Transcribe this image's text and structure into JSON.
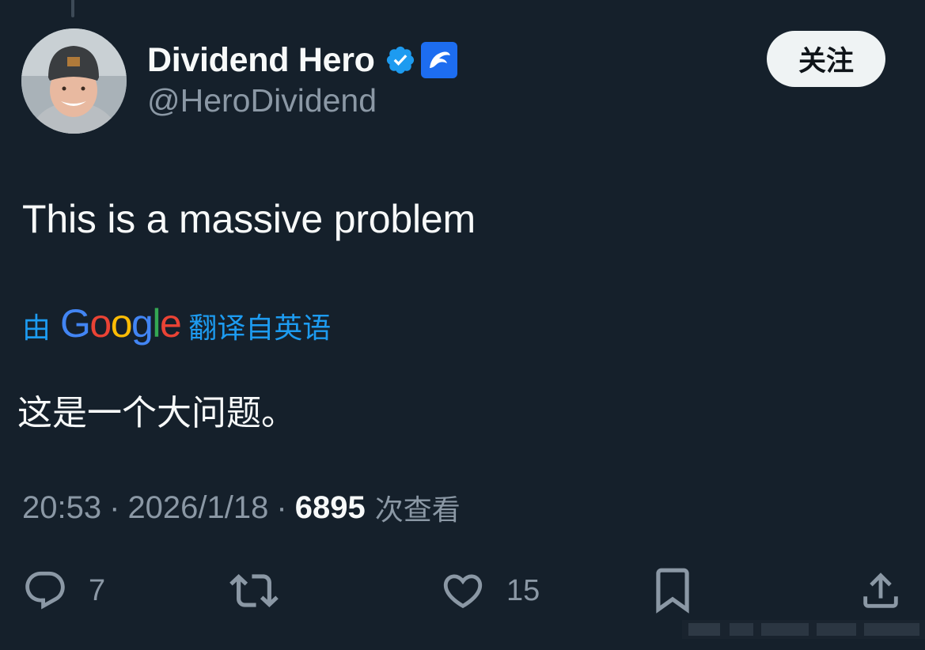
{
  "author": {
    "display_name": "Dividend Hero",
    "handle": "@HeroDividend"
  },
  "follow_label": "关注",
  "tweet": {
    "text": "This is a massive problem"
  },
  "translation": {
    "by_label": "由",
    "provider": "Google",
    "from_label": "翻译自英语",
    "text": "这是一个大问题。"
  },
  "meta": {
    "time": "20:53",
    "separator": "·",
    "date": "2026/1/18",
    "views_count": "6895",
    "views_label": "次查看"
  },
  "actions": {
    "reply_count": "7",
    "like_count": "15"
  },
  "icons": {
    "verified": "verified-badge-icon",
    "affiliate": "affiliate-badge-icon",
    "reply": "speech-bubble-icon",
    "retweet": "retweet-arrows-icon",
    "like": "heart-icon",
    "bookmark": "bookmark-icon",
    "share": "upload-share-icon"
  },
  "colors": {
    "background": "#15202b",
    "text_primary": "#f7f9f9",
    "text_secondary": "#8b98a5",
    "accent_blue": "#1d9bf0",
    "follow_button_bg": "#eff3f4"
  }
}
